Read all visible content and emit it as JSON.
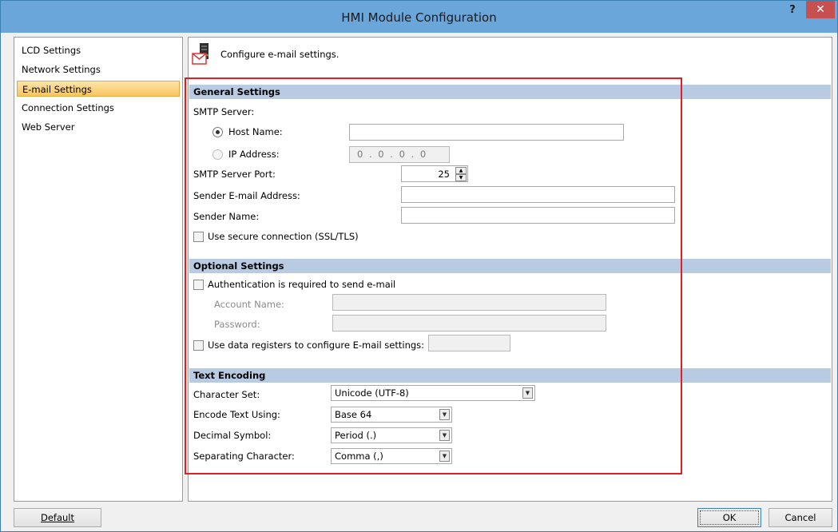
{
  "window": {
    "title": "HMI Module Configuration",
    "help": "?",
    "close": "✕"
  },
  "nav": {
    "items": [
      "LCD Settings",
      "Network Settings",
      "E-mail Settings",
      "Connection Settings",
      "Web Server"
    ],
    "selected_index": 2
  },
  "header": {
    "text": "Configure e-mail settings."
  },
  "general": {
    "title": "General Settings",
    "smtp_server": "SMTP Server:",
    "host_name": "Host Name:",
    "ip_address": "IP Address:",
    "ip_value": "0 . 0 . 0 . 0",
    "smtp_port": "SMTP Server Port:",
    "smtp_port_value": "25",
    "sender_email": "Sender E-mail Address:",
    "sender_name": "Sender Name:",
    "secure": "Use secure connection (SSL/TLS)"
  },
  "optional": {
    "title": "Optional Settings",
    "auth": "Authentication is required to send e-mail",
    "account": "Account Name:",
    "password": "Password:",
    "registers": "Use data registers to configure E-mail settings:"
  },
  "encoding": {
    "title": "Text Encoding",
    "charset_label": "Character Set:",
    "charset_value": "Unicode (UTF-8)",
    "encode_label": "Encode Text Using:",
    "encode_value": "Base 64",
    "decimal_label": "Decimal Symbol:",
    "decimal_value": "Period (.)",
    "separator_label": "Separating Character:",
    "separator_value": "Comma (,)"
  },
  "footer": {
    "default": "Default",
    "ok": "OK",
    "cancel": "Cancel"
  },
  "colors": {
    "titlebar": "#6ba6db",
    "close": "#c75050",
    "section": "#b9cbe3",
    "highlight": "#e02020",
    "selected": "#f8c560"
  }
}
